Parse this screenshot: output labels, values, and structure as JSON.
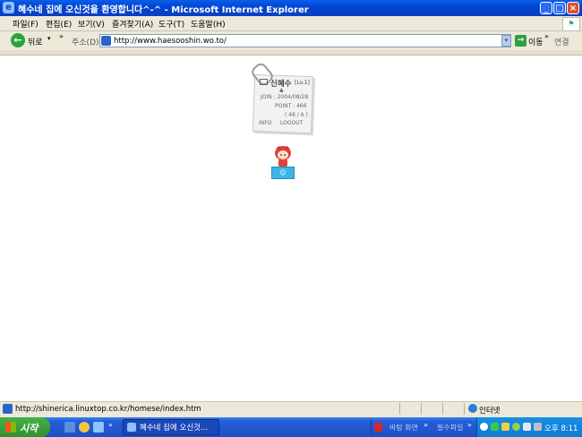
{
  "window": {
    "title": "혜수네 집에 오신것을 환영합니다^-^ - Microsoft Internet Explorer",
    "ie_glyph": "e",
    "min_glyph": "_",
    "max_glyph": "□",
    "close_glyph": "×"
  },
  "menu": {
    "items": [
      "파일(F)",
      "편집(E)",
      "보기(V)",
      "즐겨찾기(A)",
      "도구(T)",
      "도움말(H)"
    ]
  },
  "toolbar": {
    "back_label": "뒤로",
    "back_glyph": "←",
    "dropdown_glyph": "▾",
    "chevron": "»",
    "address_label": "주소(D)",
    "address_value": "http://www.haesooshin.wo.to/",
    "go_label": "이동",
    "go_glyph": "→",
    "links_label": "연결"
  },
  "page": {
    "card": {
      "name": "신혜수",
      "level": "[Lv.1]",
      "join": "JOIN : 2004/08/28",
      "point": "POINT : 466",
      "count": "( 46 / 6 )",
      "info": "INFO",
      "logout": "LOGOUT"
    }
  },
  "status": {
    "text": "http://shinerica.linuxtop.co.kr/homese/index.htm",
    "zone": "인터넷"
  },
  "taskbar": {
    "start_label": "시작",
    "task_label": "혜수네 집에 오신것...",
    "desktop_label": "바탕 화면",
    "soft_label": "필수파일",
    "chevron": "»",
    "clock": "오후 8:11"
  },
  "colors": {
    "titlebar": "#0046d5",
    "chrome": "#ece9d8",
    "taskbar": "#245edb",
    "start": "#2f8f2f"
  }
}
